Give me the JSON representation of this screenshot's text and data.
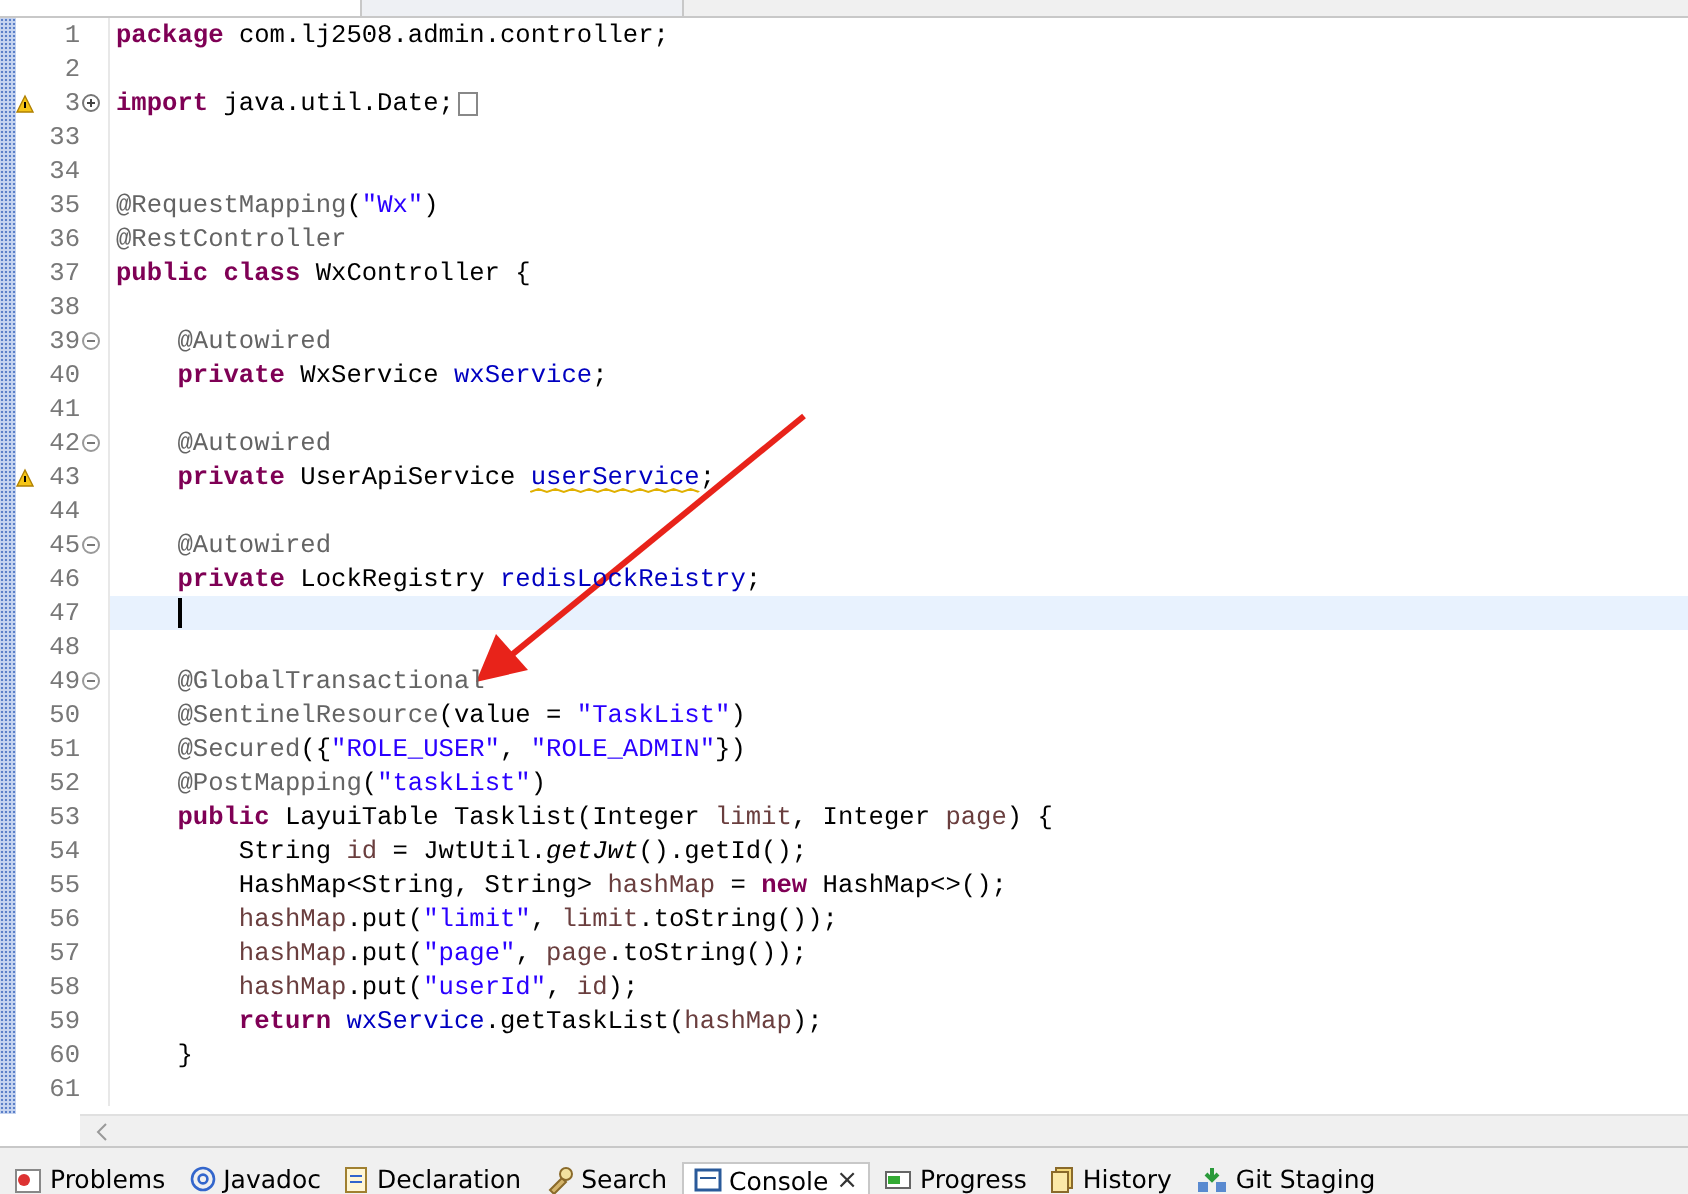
{
  "editor": {
    "lines": [
      {
        "number": "1",
        "current": false,
        "tokens": [
          {
            "kind": "keyword",
            "text": "package"
          },
          {
            "kind": "plain",
            "text": " com.lj2508.admin.controller;"
          }
        ]
      },
      {
        "number": "2",
        "current": false
      },
      {
        "number": "3",
        "collapsed": true,
        "warning": true,
        "current": false,
        "tokens": [
          {
            "kind": "keyword",
            "text": "import"
          },
          {
            "kind": "plain",
            "text": " java.util.Date;"
          }
        ]
      },
      {
        "number": "33",
        "current": false
      },
      {
        "number": "34",
        "current": false
      },
      {
        "number": "35",
        "current": false,
        "tokens": [
          {
            "kind": "annotation",
            "text": "@RequestMapping"
          },
          {
            "kind": "plain",
            "text": "("
          },
          {
            "kind": "string",
            "text": "\"Wx\""
          },
          {
            "kind": "plain",
            "text": ")"
          }
        ]
      },
      {
        "number": "36",
        "current": false,
        "tokens": [
          {
            "kind": "annotation",
            "text": "@RestController"
          }
        ]
      },
      {
        "number": "37",
        "current": false,
        "tokens": [
          {
            "kind": "keyword",
            "text": "public class"
          },
          {
            "kind": "plain",
            "text": " WxController {"
          }
        ]
      },
      {
        "number": "38",
        "current": false
      },
      {
        "number": "39",
        "collapsed": false,
        "current": false,
        "tokens": [
          {
            "kind": "annotation",
            "text": "    @Autowired"
          }
        ]
      },
      {
        "number": "40",
        "current": false,
        "tokens": [
          {
            "kind": "keyword",
            "text": "    private"
          },
          {
            "kind": "plain",
            "text": " WxService "
          },
          {
            "kind": "field",
            "text": "wxService"
          },
          {
            "kind": "plain",
            "text": ";"
          }
        ]
      },
      {
        "number": "41",
        "current": false
      },
      {
        "number": "42",
        "collapsed": false,
        "current": false,
        "tokens": [
          {
            "kind": "annotation",
            "text": "    @Autowired"
          }
        ]
      },
      {
        "number": "43",
        "warning": true,
        "current": false,
        "tokens": [
          {
            "kind": "keyword",
            "text": "    private"
          },
          {
            "kind": "plain",
            "text": " UserApiService "
          },
          {
            "kind": "field_warning",
            "text": "userService"
          },
          {
            "kind": "plain",
            "text": ";"
          }
        ]
      },
      {
        "number": "44",
        "current": false
      },
      {
        "number": "45",
        "collapsed": false,
        "current": false,
        "tokens": [
          {
            "kind": "annotation",
            "text": "    @Autowired"
          }
        ]
      },
      {
        "number": "46",
        "current": false,
        "tokens": [
          {
            "kind": "keyword",
            "text": "    private"
          },
          {
            "kind": "plain",
            "text": " LockRegistry "
          },
          {
            "kind": "field",
            "text": "redisLockReistry"
          },
          {
            "kind": "plain",
            "text": ";"
          }
        ]
      },
      {
        "number": "47",
        "current": true
      },
      {
        "number": "48",
        "current": false
      },
      {
        "number": "49",
        "collapsed": false,
        "current": false,
        "tokens": [
          {
            "kind": "annotation",
            "text": "    @GlobalTransactional"
          }
        ]
      },
      {
        "number": "50",
        "current": false,
        "tokens": [
          {
            "kind": "annotation",
            "text": "    @SentinelResource"
          },
          {
            "kind": "plain",
            "text": "(value = "
          },
          {
            "kind": "string",
            "text": "\"TaskList\""
          },
          {
            "kind": "plain",
            "text": ")"
          }
        ]
      },
      {
        "number": "51",
        "current": false,
        "tokens": [
          {
            "kind": "annotation",
            "text": "    @Secured"
          },
          {
            "kind": "plain",
            "text": "({"
          },
          {
            "kind": "string",
            "text": "\"ROLE_USER\""
          },
          {
            "kind": "plain",
            "text": ", "
          },
          {
            "kind": "string",
            "text": "\"ROLE_ADMIN\""
          },
          {
            "kind": "plain",
            "text": "})"
          }
        ]
      },
      {
        "number": "52",
        "current": false,
        "tokens": [
          {
            "kind": "annotation",
            "text": "    @PostMapping"
          },
          {
            "kind": "plain",
            "text": "("
          },
          {
            "kind": "string",
            "text": "\"taskList\""
          },
          {
            "kind": "plain",
            "text": ")"
          }
        ]
      },
      {
        "number": "53",
        "current": false,
        "tokens": [
          {
            "kind": "keyword",
            "text": "    public"
          },
          {
            "kind": "plain",
            "text": " LayuiTable Tasklist(Integer "
          },
          {
            "kind": "local",
            "text": "limit"
          },
          {
            "kind": "plain",
            "text": ", Integer "
          },
          {
            "kind": "local",
            "text": "page"
          },
          {
            "kind": "plain",
            "text": ") {"
          }
        ]
      },
      {
        "number": "54",
        "current": false,
        "tokens": [
          {
            "kind": "plain",
            "text": "        String "
          },
          {
            "kind": "local",
            "text": "id"
          },
          {
            "kind": "plain",
            "text": " = JwtUtil."
          },
          {
            "kind": "static",
            "text": "getJwt"
          },
          {
            "kind": "plain",
            "text": "().getId();"
          }
        ]
      },
      {
        "number": "55",
        "current": false,
        "tokens": [
          {
            "kind": "plain",
            "text": "        HashMap<String, String> "
          },
          {
            "kind": "local",
            "text": "hashMap"
          },
          {
            "kind": "plain",
            "text": " = "
          },
          {
            "kind": "keyword",
            "text": "new"
          },
          {
            "kind": "plain",
            "text": " HashMap<>();"
          }
        ]
      },
      {
        "number": "56",
        "current": false,
        "tokens": [
          {
            "kind": "local",
            "text": "        hashMap"
          },
          {
            "kind": "plain",
            "text": ".put("
          },
          {
            "kind": "string",
            "text": "\"limit\""
          },
          {
            "kind": "plain",
            "text": ", "
          },
          {
            "kind": "local",
            "text": "limit"
          },
          {
            "kind": "plain",
            "text": ".toString());"
          }
        ]
      },
      {
        "number": "57",
        "current": false,
        "tokens": [
          {
            "kind": "local",
            "text": "        hashMap"
          },
          {
            "kind": "plain",
            "text": ".put("
          },
          {
            "kind": "string",
            "text": "\"page\""
          },
          {
            "kind": "plain",
            "text": ", "
          },
          {
            "kind": "local",
            "text": "page"
          },
          {
            "kind": "plain",
            "text": ".toString());"
          }
        ]
      },
      {
        "number": "58",
        "current": false,
        "tokens": [
          {
            "kind": "local",
            "text": "        hashMap"
          },
          {
            "kind": "plain",
            "text": ".put("
          },
          {
            "kind": "string",
            "text": "\"userId\""
          },
          {
            "kind": "plain",
            "text": ", "
          },
          {
            "kind": "local",
            "text": "id"
          },
          {
            "kind": "plain",
            "text": ");"
          }
        ]
      },
      {
        "number": "59",
        "current": false,
        "tokens": [
          {
            "kind": "keyword",
            "text": "        return"
          },
          {
            "kind": "field",
            "text": " wxService"
          },
          {
            "kind": "plain",
            "text": ".getTaskList("
          },
          {
            "kind": "local",
            "text": "hashMap"
          },
          {
            "kind": "plain",
            "text": ");"
          }
        ]
      },
      {
        "number": "60",
        "current": false,
        "tokens": [
          {
            "kind": "plain",
            "text": "    }"
          }
        ]
      },
      {
        "number": "61",
        "current": false
      }
    ]
  },
  "bottom_tabs": [
    {
      "label": "Problems",
      "selected": false
    },
    {
      "label": "Javadoc",
      "selected": false
    },
    {
      "label": "Declaration",
      "selected": false
    },
    {
      "label": "Search",
      "selected": false
    },
    {
      "label": "Console",
      "selected": true,
      "close": "×"
    },
    {
      "label": "Progress",
      "selected": false
    },
    {
      "label": "History",
      "selected": false
    },
    {
      "label": "Git Staging",
      "selected": false
    }
  ]
}
